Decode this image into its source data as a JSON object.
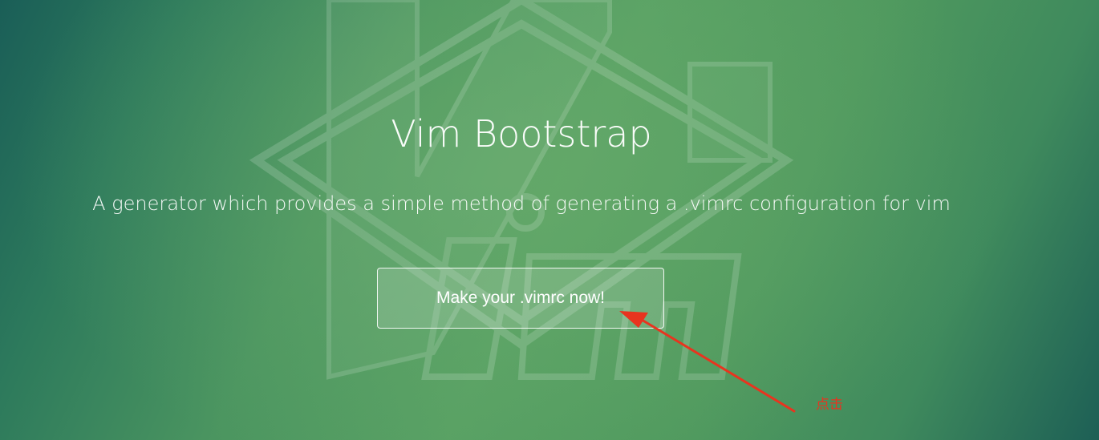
{
  "hero": {
    "title": "Vim Bootstrap",
    "subtitle": "A generator which provides a simple method of generating a .vimrc configuration for vim",
    "cta_label": "Make your .vimrc now!",
    "background_colors": [
      "#1a5e57",
      "#57a063",
      "#1d5f55"
    ],
    "logo": "vim-logo-watermark"
  },
  "annotation": {
    "label": "点击",
    "color": "#e8341f",
    "icon": "red-arrow-icon"
  }
}
